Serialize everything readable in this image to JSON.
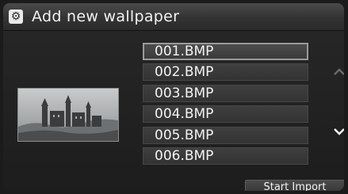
{
  "header": {
    "title": "Add new wallpaper",
    "icon": "settings-gear-icon"
  },
  "preview": {
    "icon": "castle-image-thumbnail"
  },
  "file_list": {
    "items": [
      "001.BMP",
      "002.BMP",
      "003.BMP",
      "004.BMP",
      "005.BMP",
      "006.BMP"
    ],
    "selected": "001.BMP"
  },
  "scroll": {
    "up_icon": "chevron-up-icon",
    "down_icon": "chevron-down-icon"
  },
  "actions": {
    "start_import_label": "Start Import"
  },
  "colors": {
    "background": "#202020",
    "text": "#f2f2f2",
    "selected_border": "#9a9a9a"
  }
}
